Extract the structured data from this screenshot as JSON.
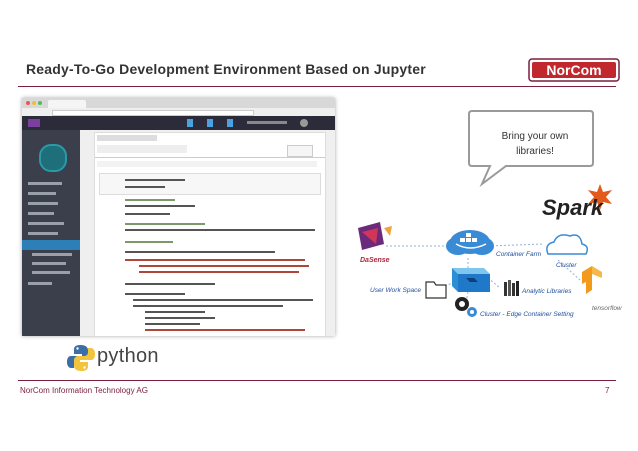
{
  "slide": {
    "title": "Ready-To-Go Development Environment Based on Jupyter",
    "footer_left": "NorCom Information Technology AG",
    "page_number": "7",
    "logo_text": "NorCom"
  },
  "callout": {
    "text": "Bring your own libraries!"
  },
  "python_logo_text": "python",
  "spark_logo_text": "Spark",
  "diagram": {
    "labels": {
      "dasense": "DaSense",
      "container_farm": "Container Farm",
      "cluster": "Cluster",
      "user_work_space": "User Work Space",
      "analytic_libraries": "Analytic Libraries",
      "cluster_edge": "Cluster - Edge Container Setting",
      "tensorflow": "tensorflow"
    }
  },
  "colors": {
    "accent": "#7a1f3d",
    "logo_red": "#c0282d",
    "diagram_blue": "#1f4e9e",
    "container_blue": "#2b8fd6",
    "callout_border": "#9a9a9a"
  }
}
